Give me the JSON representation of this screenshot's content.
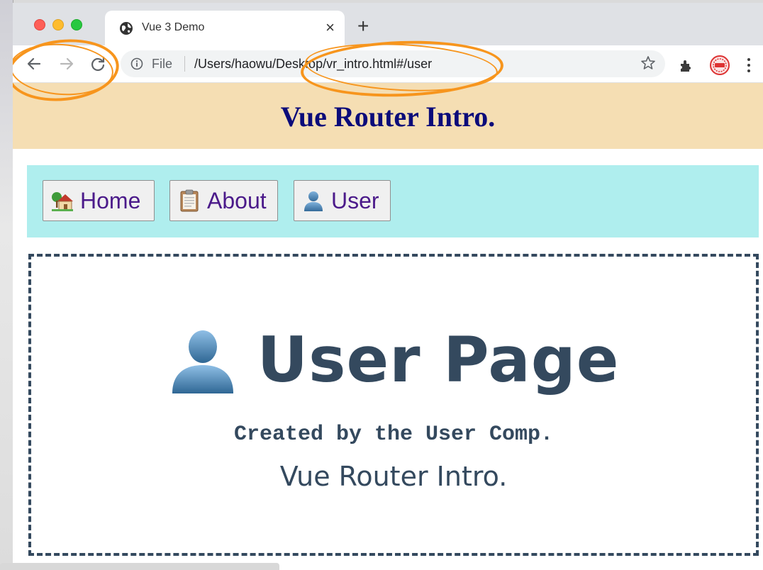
{
  "tab": {
    "title": "Vue 3 Demo"
  },
  "omnibox": {
    "scheme": "File",
    "url": "/Users/haowu/Desktop/vr_intro.html#/user"
  },
  "page": {
    "header_title": "Vue Router Intro.",
    "nav": [
      {
        "label": "Home",
        "icon": "house-with-garden-icon"
      },
      {
        "label": "About",
        "icon": "clipboard-icon"
      },
      {
        "label": "User",
        "icon": "bust-in-silhouette-icon"
      }
    ],
    "content": {
      "title": "User Page",
      "created_by": "Created by the User Comp.",
      "subtitle": "Vue Router Intro."
    }
  },
  "colors": {
    "header_band": "#f5deb3",
    "nav_band": "#afeeee",
    "highlight": "#f7951d",
    "text_dark": "#34495e",
    "header_title": "#0b0b7a",
    "nav_text": "#4b1a8a"
  }
}
